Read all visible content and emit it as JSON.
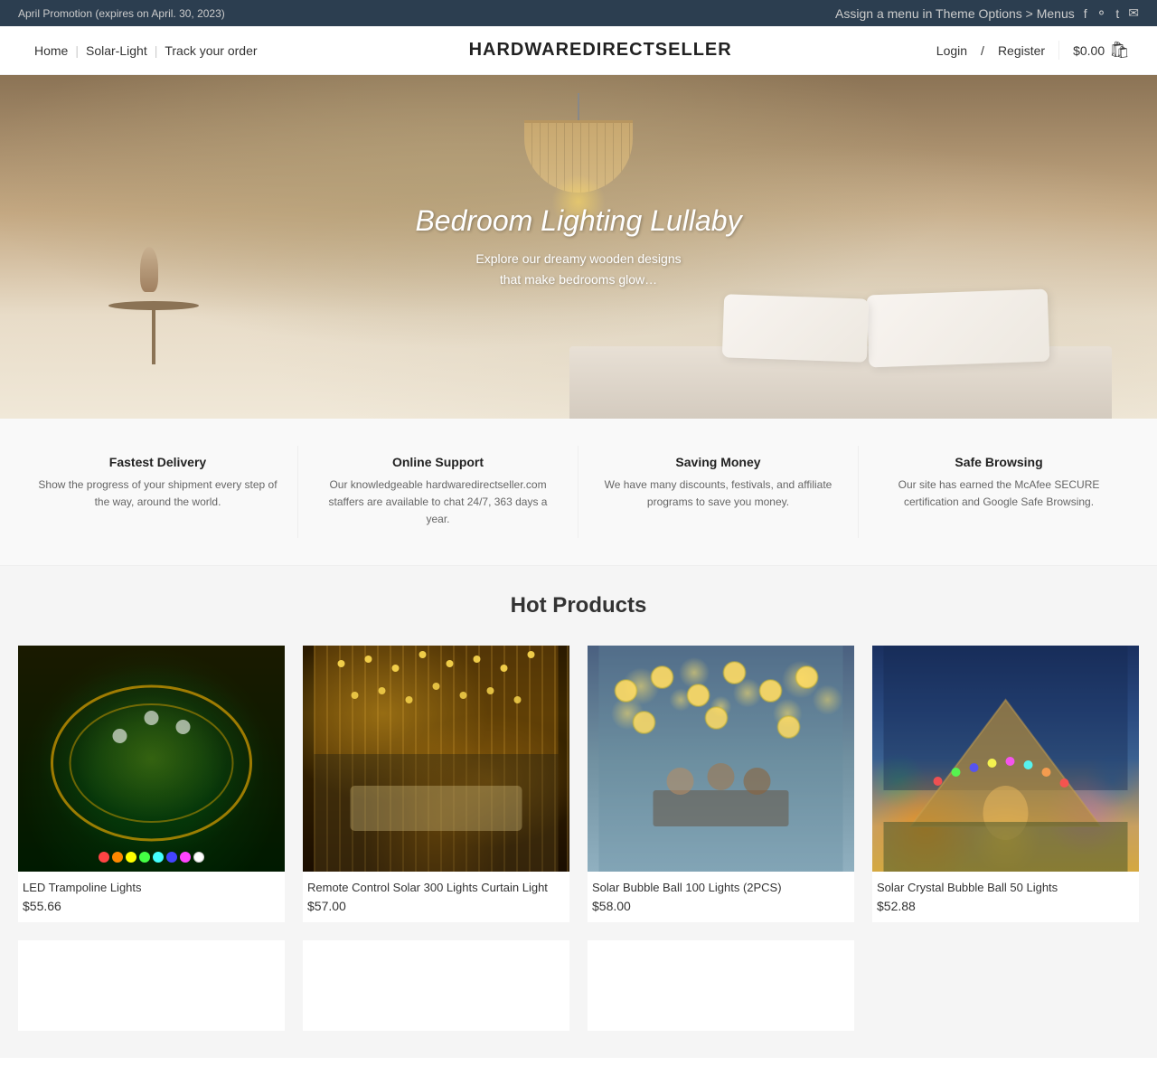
{
  "topbar": {
    "promo": "April Promotion (expires on April. 30, 2023)",
    "menu_link": "Assign a menu in Theme Options > Menus"
  },
  "header": {
    "brand": "HARDWAREDIRECTSELLER",
    "nav": [
      {
        "label": "Home",
        "href": "#"
      },
      {
        "label": "Solar-Light",
        "href": "#"
      },
      {
        "label": "Track your order",
        "href": "#"
      }
    ],
    "login": "Login",
    "register": "Register",
    "cart_amount": "$0.00"
  },
  "hero": {
    "title": "Bedroom Lighting Lullaby",
    "subtitle_line1": "Explore our dreamy wooden designs",
    "subtitle_line2": "that make bedrooms glow…"
  },
  "features": [
    {
      "title": "Fastest Delivery",
      "desc": "Show the progress of your shipment every step of the way, around the world."
    },
    {
      "title": "Online Support",
      "desc": "Our knowledgeable hardwaredirectseller.com staffers are available to chat 24/7, 363 days a year."
    },
    {
      "title": "Saving Money",
      "desc": "We have many discounts, festivals, and affiliate programs to save you money."
    },
    {
      "title": "Safe Browsing",
      "desc": "Our site has earned the McAfee SECURE certification and Google Safe Browsing."
    }
  ],
  "hot_products": {
    "section_title": "Hot Products",
    "products": [
      {
        "name": "LED Trampoline Lights",
        "price": "$55.66",
        "image_type": "trampoline"
      },
      {
        "name": "Remote Control Solar 300 Lights Curtain Light",
        "price": "$57.00",
        "image_type": "curtain"
      },
      {
        "name": "Solar Bubble Ball 100 Lights (2PCS)",
        "price": "$58.00",
        "image_type": "bubble"
      },
      {
        "name": "Solar Crystal Bubble Ball 50 Lights",
        "price": "$52.88",
        "image_type": "crystal"
      }
    ]
  },
  "colors": {
    "topbar_bg": "#2c3e50",
    "accent": "#e8a000",
    "brand_color": "#222"
  }
}
